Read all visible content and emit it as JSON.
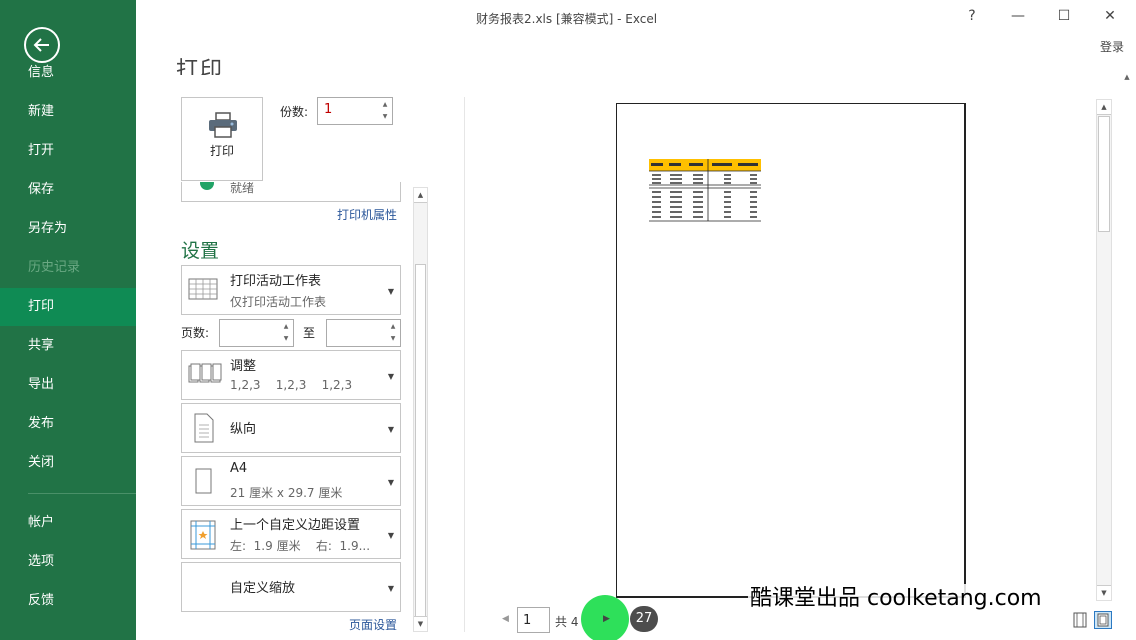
{
  "window": {
    "title": "财务报表2.xls  [兼容模式] - Excel",
    "help": "?",
    "minimize": "—",
    "maximize": "☐",
    "close": "✕",
    "login": "登录"
  },
  "sidebar": {
    "items": [
      {
        "label": "信息",
        "state": "normal"
      },
      {
        "label": "新建",
        "state": "normal"
      },
      {
        "label": "打开",
        "state": "normal"
      },
      {
        "label": "保存",
        "state": "normal"
      },
      {
        "label": "另存为",
        "state": "normal"
      },
      {
        "label": "历史记录",
        "state": "disabled"
      },
      {
        "label": "打印",
        "state": "active"
      },
      {
        "label": "共享",
        "state": "normal"
      },
      {
        "label": "导出",
        "state": "normal"
      },
      {
        "label": "发布",
        "state": "normal"
      },
      {
        "label": "关闭",
        "state": "normal"
      },
      {
        "label": "帐户",
        "state": "normal"
      },
      {
        "label": "选项",
        "state": "normal"
      },
      {
        "label": "反馈",
        "state": "normal"
      }
    ]
  },
  "print": {
    "heading": "打印",
    "button_label": "打印",
    "copies_label": "份数:",
    "copies_value": "1",
    "printer_status": "就绪",
    "printer_properties": "打印机属性"
  },
  "settings": {
    "heading": "设置",
    "scope": {
      "title": "打印活动工作表",
      "subtitle": "仅打印活动工作表"
    },
    "pages_label": "页数:",
    "to_label": "至",
    "collate": {
      "title": "调整",
      "subtitle": "1,2,3    1,2,3    1,2,3"
    },
    "orientation": {
      "title": "纵向"
    },
    "paper": {
      "title": "A4",
      "subtitle": "21 厘米 x 29.7 厘米"
    },
    "margins": {
      "title": "上一个自定义边距设置",
      "subtitle": "左:  1.9 厘米    右:  1.9..."
    },
    "scaling": {
      "title": "自定义缩放"
    },
    "page_setup": "页面设置"
  },
  "preview": {
    "current_page": "1",
    "total_text": "共 4 页",
    "badge": "27"
  },
  "watermark": "酷课堂出品 coolketang.com",
  "colors": {
    "sidebar": "#217346",
    "active": "#0f8b54",
    "accent": "#217346",
    "link": "#2b579a",
    "table_header": "#ffc000"
  }
}
